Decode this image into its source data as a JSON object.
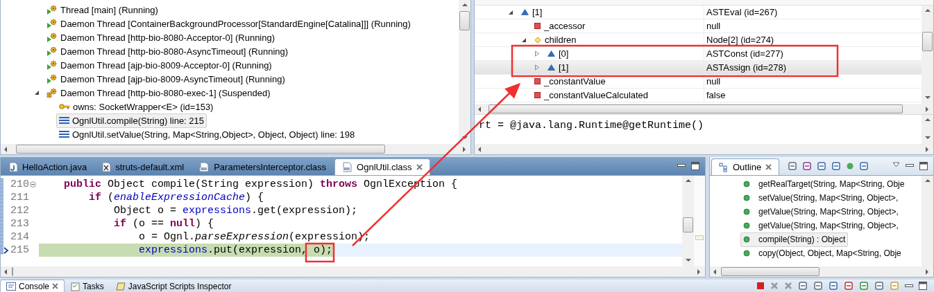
{
  "debug_view": {
    "threads": [
      {
        "label": "Thread [main] (Running)",
        "kind": "running",
        "expanded": false,
        "selected": false
      },
      {
        "label": "Daemon Thread [ContainerBackgroundProcessor[StandardEngine[Catalina]]] (Running)",
        "kind": "running",
        "expanded": false,
        "selected": false
      },
      {
        "label": "Daemon Thread [http-bio-8080-Acceptor-0] (Running)",
        "kind": "running",
        "expanded": false,
        "selected": false
      },
      {
        "label": "Daemon Thread [http-bio-8080-AsyncTimeout] (Running)",
        "kind": "running",
        "expanded": false,
        "selected": false
      },
      {
        "label": "Daemon Thread [ajp-bio-8009-Acceptor-0] (Running)",
        "kind": "running",
        "expanded": false,
        "selected": false
      },
      {
        "label": "Daemon Thread [ajp-bio-8009-AsyncTimeout] (Running)",
        "kind": "running",
        "expanded": false,
        "selected": false
      },
      {
        "label": "Daemon Thread [http-bio-8080-exec-1] (Suspended)",
        "kind": "suspended",
        "expanded": true,
        "selected": false,
        "children": [
          {
            "kind": "monitor",
            "label": "owns: SocketWrapper<E>  (id=153)",
            "selected": false
          },
          {
            "kind": "frame",
            "label": "OgnlUtil.compile(String) line: 215",
            "selected": true
          },
          {
            "kind": "frame",
            "label": "OgnlUtil.setValue(String, Map<String,Object>, Object, Object) line: 198",
            "selected": false
          }
        ]
      }
    ]
  },
  "variables_view": {
    "rows": [
      {
        "name": "[1]",
        "value": "ASTEval  (id=267)",
        "kind": "object",
        "expanded": true,
        "selected": false,
        "children": [
          {
            "name": "_accessor",
            "value": "null",
            "kind": "field",
            "selected": false
          },
          {
            "name": "children",
            "value": "Node[2]  (id=274)",
            "kind": "array",
            "expanded": true,
            "selected": false,
            "children": [
              {
                "name": "[0]",
                "value": "ASTConst  (id=277)",
                "kind": "object",
                "expanded": false,
                "selected": false
              },
              {
                "name": "[1]",
                "value": "ASTAssign  (id=278)",
                "kind": "object",
                "expanded": false,
                "selected": true
              }
            ]
          },
          {
            "name": "_constantValue",
            "value": "null",
            "kind": "field",
            "selected": false
          },
          {
            "name": "_constantValueCalculated",
            "value": "false",
            "kind": "field",
            "selected": false
          }
        ]
      }
    ],
    "detail": "rt = @java.lang.Runtime@getRuntime()"
  },
  "editor": {
    "tabs": [
      {
        "label": "HelloAction.java",
        "kind": "java",
        "selected": false
      },
      {
        "label": "struts-default.xml",
        "kind": "xml",
        "selected": false
      },
      {
        "label": "ParametersInterceptor.class",
        "kind": "class",
        "selected": false
      },
      {
        "label": "OgnlUtil.class",
        "kind": "class",
        "selected": true
      }
    ],
    "lines": [
      {
        "number": "210",
        "foldable": true,
        "current": false,
        "tokens": [
          {
            "text": "    public",
            "kind": "keyword"
          },
          {
            "text": " Object compile(String expression) ",
            "kind": "plain"
          },
          {
            "text": "throws",
            "kind": "keyword"
          },
          {
            "text": " OgnlException {",
            "kind": "plain"
          }
        ]
      },
      {
        "number": "211",
        "foldable": false,
        "current": false,
        "tokens": [
          {
            "text": "        if",
            "kind": "keyword"
          },
          {
            "text": " (",
            "kind": "plain"
          },
          {
            "text": "enableExpressionCache",
            "kind": "static-field"
          },
          {
            "text": ") {",
            "kind": "plain"
          }
        ]
      },
      {
        "number": "212",
        "foldable": false,
        "current": false,
        "tokens": [
          {
            "text": "            Object o = ",
            "kind": "plain"
          },
          {
            "text": "expressions",
            "kind": "field"
          },
          {
            "text": ".get(expression);",
            "kind": "plain"
          }
        ]
      },
      {
        "number": "213",
        "foldable": false,
        "current": false,
        "tokens": [
          {
            "text": "            if",
            "kind": "keyword"
          },
          {
            "text": " (o == ",
            "kind": "plain"
          },
          {
            "text": "null",
            "kind": "keyword"
          },
          {
            "text": ") {",
            "kind": "plain"
          }
        ]
      },
      {
        "number": "214",
        "foldable": false,
        "current": false,
        "tokens": [
          {
            "text": "                o = Ognl.",
            "kind": "plain"
          },
          {
            "text": "parseExpression",
            "kind": "static-method"
          },
          {
            "text": "(expression);",
            "kind": "plain"
          }
        ]
      },
      {
        "number": "215",
        "foldable": false,
        "current": true,
        "tokens": [
          {
            "text": "                expressions",
            "kind": "field"
          },
          {
            "text": ".put(expression, o);",
            "kind": "plain"
          }
        ]
      }
    ]
  },
  "outline": {
    "title": "Outline",
    "items": [
      {
        "label": "getRealTarget(String, Map<String, Obje",
        "selected": false
      },
      {
        "label": "setValue(String, Map<String, Object>,",
        "selected": false
      },
      {
        "label": "getValue(String, Map<String, Object>,",
        "selected": false
      },
      {
        "label": "getValue(String, Map<String, Object>,",
        "selected": false
      },
      {
        "label": "compile(String) : Object",
        "selected": true
      },
      {
        "label": "copy(Object, Object, Map<String, Obje",
        "selected": false
      }
    ]
  },
  "bottom_tabs": [
    {
      "label": "Console",
      "kind": "console",
      "selected": true
    },
    {
      "label": "Tasks",
      "kind": "tasks",
      "selected": false
    },
    {
      "label": "JavaScript Scripts Inspector",
      "kind": "script",
      "selected": false
    }
  ]
}
